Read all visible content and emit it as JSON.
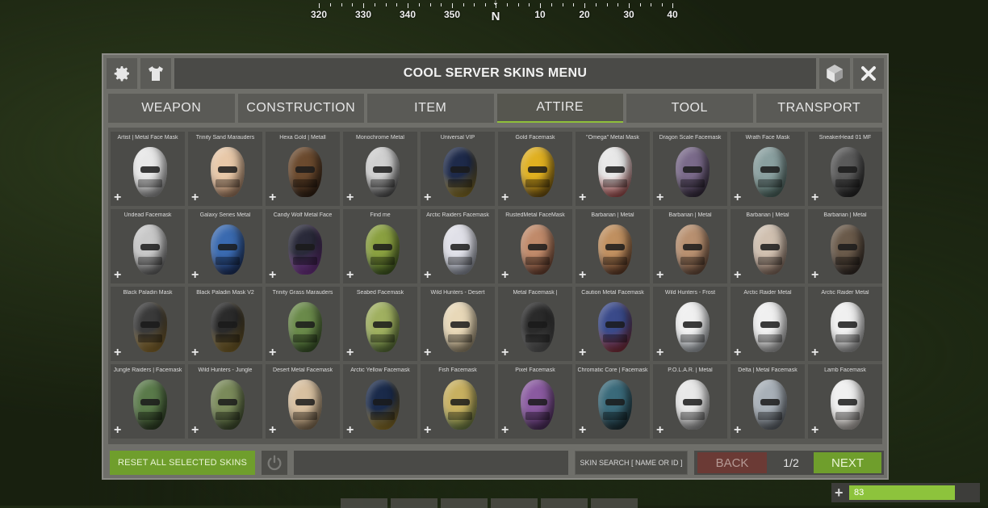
{
  "compass": {
    "ticks": [
      "320",
      "330",
      "340",
      "350",
      "N",
      "10",
      "20",
      "30",
      "40"
    ],
    "marker": "⇣"
  },
  "window": {
    "title": "COOL SERVER SKINS MENU",
    "icons": {
      "left_1": "gear-icon",
      "left_2": "shirt-icon",
      "right_1": "cube-icon",
      "right_2": "close-icon"
    }
  },
  "tabs": [
    {
      "label": "WEAPON",
      "active": false
    },
    {
      "label": "CONSTRUCTION",
      "active": false
    },
    {
      "label": "ITEM",
      "active": false
    },
    {
      "label": "ATTIRE",
      "active": true
    },
    {
      "label": "TOOL",
      "active": false
    },
    {
      "label": "TRANSPORT",
      "active": false
    }
  ],
  "skins": [
    {
      "name": "Artist | Metal Face Mask",
      "colors": [
        "#e8e8e8",
        "#9a9a9a"
      ]
    },
    {
      "name": "Trinity Sand Marauders",
      "colors": [
        "#e8c8a8",
        "#b08060"
      ]
    },
    {
      "name": "Hexa Gold | Metall",
      "colors": [
        "#6b4a2e",
        "#2a1a10"
      ]
    },
    {
      "name": "Monochrome Metal",
      "colors": [
        "#d0d0d0",
        "#3a3a3a"
      ]
    },
    {
      "name": "Universal VIP",
      "colors": [
        "#1e2a4a",
        "#c8a020"
      ]
    },
    {
      "name": "Gold Facemask",
      "colors": [
        "#e0b020",
        "#6a4a10"
      ]
    },
    {
      "name": "\"Omega\" Metal Mask",
      "colors": [
        "#e8e8e8",
        "#b03030"
      ]
    },
    {
      "name": "Dragon Scale Facemask",
      "colors": [
        "#7a6a8a",
        "#2a2030"
      ]
    },
    {
      "name": "Wrath Face Mask",
      "colors": [
        "#8aa0a0",
        "#4a6a60"
      ]
    },
    {
      "name": "SneakerHead 01 MF",
      "colors": [
        "#5a5a5a",
        "#1a1a1a"
      ]
    },
    {
      "name": "Undead Facemask",
      "colors": [
        "#c8c8c8",
        "#5a5a5a"
      ]
    },
    {
      "name": "Galaxy Series Metal",
      "colors": [
        "#3a6ab0",
        "#1a2a5a"
      ]
    },
    {
      "name": "Candy Wolf Metal Face",
      "colors": [
        "#2a2a3a",
        "#a040c0"
      ]
    },
    {
      "name": "Find me",
      "colors": [
        "#8aa040",
        "#3a5a20"
      ]
    },
    {
      "name": "Arctic Raiders Facemask",
      "colors": [
        "#e0e0e8",
        "#9098a8"
      ]
    },
    {
      "name": "RustedMetal FaceMask",
      "colors": [
        "#c08a6a",
        "#6a3a2a"
      ]
    },
    {
      "name": "Barbarian | Metal",
      "colors": [
        "#c09060",
        "#5a3020"
      ]
    },
    {
      "name": "Barbarian | Metal",
      "colors": [
        "#b89070",
        "#6a4a3a"
      ]
    },
    {
      "name": "Barbarian | Metal",
      "colors": [
        "#d0c0b0",
        "#8a6a5a"
      ]
    },
    {
      "name": "Barbarian | Metal",
      "colors": [
        "#6a5a4a",
        "#2a2220"
      ]
    },
    {
      "name": "Black Paladin Mask",
      "colors": [
        "#3a3a3a",
        "#c09030"
      ]
    },
    {
      "name": "Black Paladin Mask V2",
      "colors": [
        "#2a2a2a",
        "#b08a30"
      ]
    },
    {
      "name": "Trinity Grass Marauders",
      "colors": [
        "#6a8a4a",
        "#3a5a2a"
      ]
    },
    {
      "name": "Seabed Facemask",
      "colors": [
        "#a0b060",
        "#5a7a3a"
      ]
    },
    {
      "name": "Wild Hunters - Desert",
      "colors": [
        "#e8d8b8",
        "#a09070"
      ]
    },
    {
      "name": "Metal Facemask |",
      "colors": [
        "#2a2a2a",
        "#7a7a7a"
      ]
    },
    {
      "name": "Caution Metal Facemask",
      "colors": [
        "#3a4a8a",
        "#b03030"
      ]
    },
    {
      "name": "Wild Hunters - Frost",
      "colors": [
        "#f0f0f0",
        "#a8b0b8"
      ]
    },
    {
      "name": "Arctic Raider Metal",
      "colors": [
        "#f0f0f0",
        "#b0b0b0"
      ]
    },
    {
      "name": "Arctic Raider Metal",
      "colors": [
        "#f0f0f0",
        "#a0a0a0"
      ]
    },
    {
      "name": "Jungle Raiders | Facemask",
      "colors": [
        "#5a7a4a",
        "#2a3a20"
      ]
    },
    {
      "name": "Wild Hunters - Jungle",
      "colors": [
        "#7a8a5a",
        "#3a4a2a"
      ]
    },
    {
      "name": "Desert Metal Facemask",
      "colors": [
        "#d8c0a0",
        "#8a7050"
      ]
    },
    {
      "name": "Arctic Yellow Facemask",
      "colors": [
        "#1a2a4a",
        "#d0a020"
      ]
    },
    {
      "name": "Fish Facemask",
      "colors": [
        "#c8b060",
        "#6a8a4a"
      ]
    },
    {
      "name": "Pixel Facemask",
      "colors": [
        "#8a5aa0",
        "#4a2a5a"
      ]
    },
    {
      "name": "Chromatic Core | Facemask",
      "colors": [
        "#3a6a7a",
        "#1a2a30"
      ]
    },
    {
      "name": "P.O.L.A.R. | Metal",
      "colors": [
        "#e8e8e8",
        "#a0a0a0"
      ]
    },
    {
      "name": "Delta | Metal Facemask",
      "colors": [
        "#a8b0b8",
        "#5a6068"
      ]
    },
    {
      "name": "Lamb Facemask",
      "colors": [
        "#f0f0f0",
        "#c0b8b0"
      ]
    }
  ],
  "skin_add_symbol": "+",
  "footer": {
    "reset_label": "RESET ALL SELECTED SKINS",
    "search_label": "SKIN SEARCH   [ NAME OR ID ]",
    "back_label": "BACK",
    "page_indicator": "1/2",
    "next_label": "NEXT"
  },
  "status": {
    "value": "83",
    "level": 0.83,
    "icon": "+"
  },
  "colors": {
    "accent_green": "#6f9e2c",
    "back_red": "#6b3a35",
    "status_green": "#8dc33c"
  }
}
